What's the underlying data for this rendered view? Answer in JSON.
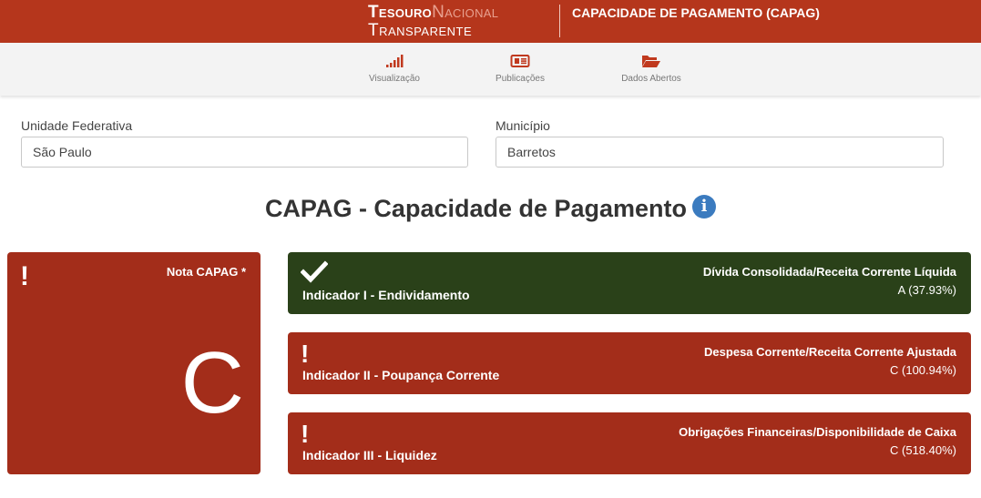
{
  "header": {
    "logo_part1": "Tesouro",
    "logo_part2": "Nacional",
    "logo_line2": "Transparente",
    "page_title": "CAPACIDADE DE PAGAMENTO (CAPAG)"
  },
  "nav": {
    "items": [
      {
        "label": "Visualização",
        "icon": "signal-bars-icon"
      },
      {
        "label": "Publicações",
        "icon": "newspaper-icon"
      },
      {
        "label": "Dados Abertos",
        "icon": "folder-open-icon"
      }
    ]
  },
  "filters": {
    "uf_label": "Unidade Federativa",
    "uf_value": "São Paulo",
    "municipio_label": "Município",
    "municipio_value": "Barretos"
  },
  "main": {
    "title": "CAPAG - Capacidade de Pagamento",
    "info_icon": "info-circle-icon"
  },
  "nota": {
    "title": "Nota CAPAG *",
    "grade": "C",
    "status_icon": "exclamation-icon",
    "color": "#a32d1a"
  },
  "indicators": [
    {
      "name": "Indicador I - Endividamento",
      "metric": "Dívida Consolidada/Receita Corrente Líquida",
      "value": "A (37.93%)",
      "status_icon": "check-icon",
      "color": "#2a4119"
    },
    {
      "name": "Indicador II - Poupança Corrente",
      "metric": "Despesa Corrente/Receita Corrente Ajustada",
      "value": "C (100.94%)",
      "status_icon": "exclamation-icon",
      "color": "#a32d1a"
    },
    {
      "name": "Indicador III - Liquidez",
      "metric": "Obrigações Financeiras/Disponibilidade de Caixa",
      "value": "C (518.40%)",
      "status_icon": "exclamation-icon",
      "color": "#a32d1a"
    }
  ],
  "colors": {
    "topbar": "#b5361c",
    "nav_icon": "#c0391e",
    "info": "#3b7bbf"
  }
}
